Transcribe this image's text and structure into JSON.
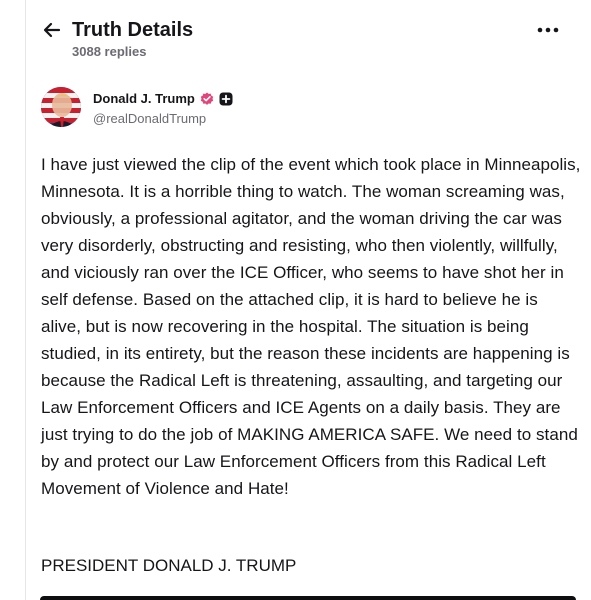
{
  "header": {
    "title": "Truth Details",
    "reply_count": "3088 replies",
    "back_icon": "arrow-left-icon",
    "more_icon": "more-horizontal-icon"
  },
  "author": {
    "name": "Donald J. Trump",
    "handle": "@realDonaldTrump",
    "verified_badge_color": "#e2457a",
    "avatar": "user-avatar"
  },
  "post": {
    "body": "I have just viewed the clip of the event which took place in Minneapolis, Minnesota. It is a horrible thing to watch. The woman screaming was, obviously, a professional agitator, and the woman driving the car was very disorderly, obstructing and resisting, who then violently, willfully, and viciously ran over the ICE Officer, who seems to have shot her in self defense. Based on the attached clip, it is hard to believe he is alive, but is now recovering in the hospital. The situation is being studied, in its entirety, but the reason these incidents are happening is because the Radical Left is threatening, assaulting, and targeting our Law Enforcement Officers and ICE Agents on a daily basis. They are just trying to do the job of MAKING AMERICA SAFE. We need to stand by and protect our Law Enforcement Officers from this Radical Left Movement of Violence and Hate!",
    "signature": "PRESIDENT DONALD J. TRUMP"
  }
}
